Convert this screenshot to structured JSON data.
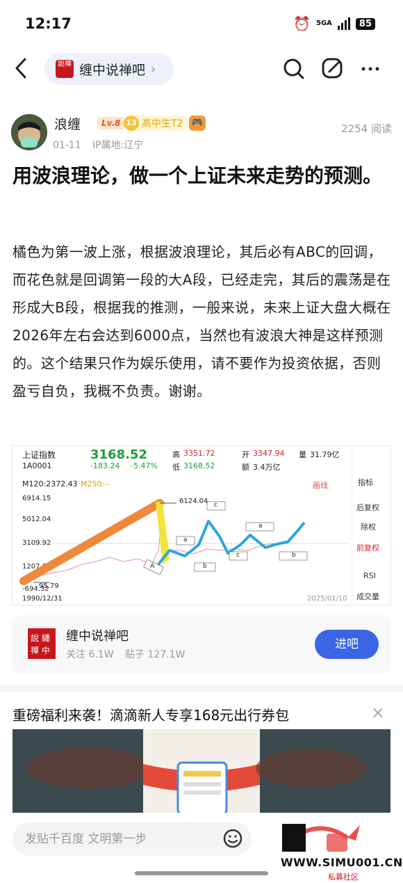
{
  "status_bar": {
    "time": "12:17",
    "signal": "5GA",
    "battery": "85"
  },
  "nav": {
    "forum_name": "缠中说禅吧",
    "forum_logo_text": "說禪"
  },
  "author": {
    "name": "浪缠",
    "level": "Lv.8",
    "rank_number": "13",
    "rank_title": "高中生T2",
    "date": "01-11",
    "ip_location": "IP属地:辽宁",
    "views": "2254 阅读"
  },
  "post": {
    "title": "用波浪理论，做一个上证未来走势的预测。",
    "body": "橘色为第一波上涨，根据波浪理论，其后必有ABC的回调，而花色就是回调第一段的大A段，已经走完，其后的震荡是在形成大B段，根据我的推测，一般来说，未来上证大盘大概在2026年左右会达到6000点，当然也有波浪大神是这样预测的。这个结果只作为娱乐使用，请不要作为投资依据，否则盈亏自负，我概不负责。谢谢。"
  },
  "chart_image": {
    "index_name": "上证指数",
    "index_code": "1A0001",
    "price": "3168.52",
    "change": "-183.24",
    "change_pct": "-5.47%",
    "high_label": "高",
    "high": "3351.72",
    "low_label": "低",
    "low": "3168.52",
    "open_label": "开",
    "open": "3347.94",
    "amount_label": "额",
    "amount": "3.4万亿",
    "volume_label": "量",
    "volume": "31.79亿",
    "ma120": "M120:2372.43",
    "ma250": "M250:--",
    "draw_line": "画线",
    "axis_values": [
      "6914.15",
      "5012.04",
      "3109.92",
      "1207.80",
      "-694.32"
    ],
    "peak_label": "6124.04",
    "low_point_label": "95.79",
    "start_date": "1990/12/31",
    "end_date": "2025/01/10",
    "wave_labels": [
      "a",
      "b",
      "c",
      "a",
      "b",
      "c",
      "A"
    ],
    "side_menu": [
      "指标",
      "后复权",
      "除权",
      "前复权",
      "RSI",
      "成交量"
    ]
  },
  "forum_card": {
    "name": "缠中说禅吧",
    "followers": "关注 6.1W",
    "posts": "贴子 127.1W",
    "enter_label": "进吧"
  },
  "ad": {
    "title": "重磅福利来袭！滴滴新人专享168元出行券包",
    "close": "×"
  },
  "bottom_bar": {
    "reply_placeholder": "发贴千百度 文明第一步"
  },
  "watermark": {
    "url": "WWW.SIMU001.CN",
    "sub": "私募社区"
  },
  "colors": {
    "accent": "#3a65e5",
    "up_red": "#e02020",
    "down_green": "#1b9e3a",
    "wave_orange": "#f0883c",
    "wave_yellow": "#f5e23a",
    "wave_blue": "#2aa6e0"
  }
}
